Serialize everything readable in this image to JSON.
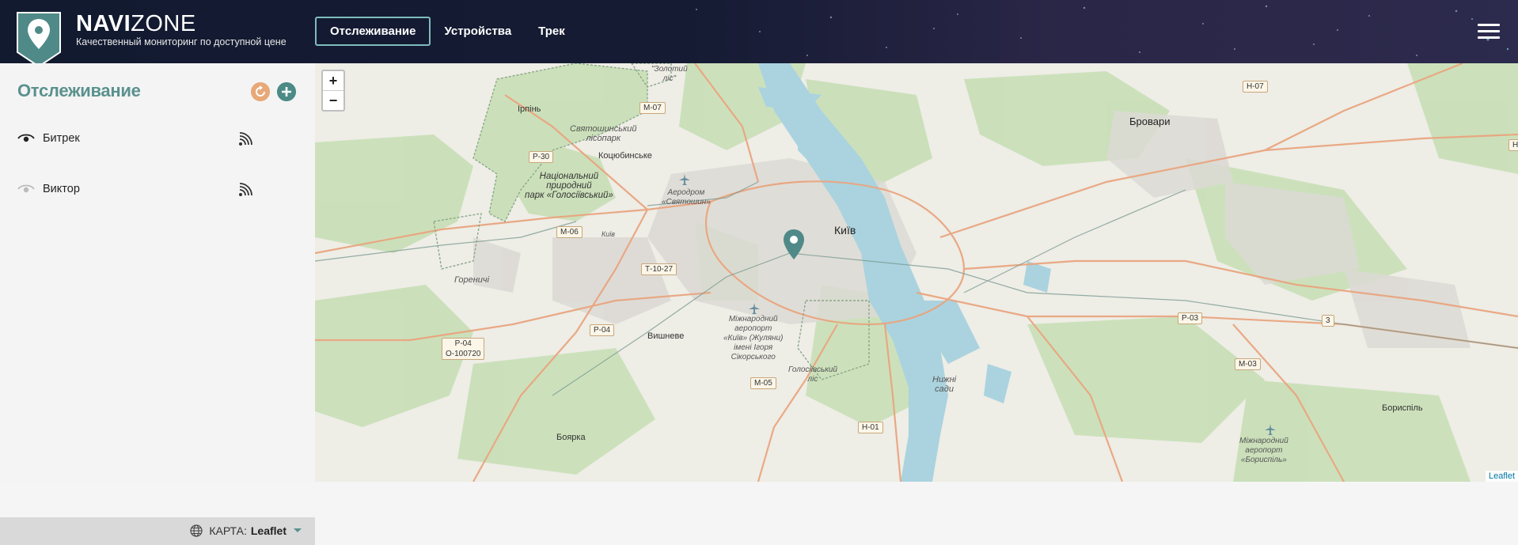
{
  "header": {
    "brand_bold": "NAVI",
    "brand_light": "ZONE",
    "tagline": "Качественный мониторинг по доступной цене",
    "tabs": [
      {
        "label": "Отслеживание"
      },
      {
        "label": "Устройства"
      },
      {
        "label": "Трек"
      }
    ]
  },
  "sidebar": {
    "title": "Отслеживание",
    "devices": [
      {
        "name": "Битрек",
        "visible": true
      },
      {
        "name": "Виктор",
        "visible": false
      }
    ],
    "map_label": "КАРТА:",
    "map_value": "Leaflet"
  },
  "map": {
    "zoom_in": "+",
    "zoom_out": "−",
    "attribution": "Leaflet",
    "places": {
      "irpin": "Ірпінь",
      "kotsiubynske": "Коцюбинське",
      "kyiv": "Київ",
      "brovary": "Бровари",
      "vyshneve": "Вишневе",
      "boiarka": "Боярка",
      "boryspil": "Бориспіль",
      "horenychi": "Гореничі",
      "kyiv_small": "Київ",
      "nyzhni_sady": "Нижні\nсади"
    },
    "areas": {
      "zolotyi_lis": "\"Золотий\nліс\"",
      "sviatoshynskyi": "Святошинський\nлісопарк",
      "nat_park": "Національний\nприродний\nпарк «Голосіївський»",
      "aerodrom": "Аеродром\n«Святошин»",
      "airport": "Міжнародний\nаеропорт\n«Київ» (Жуляни)\nімені Ігоря\nСікорського",
      "holosiivskyi": "Голосіївський\nліс",
      "boryspil_airport": "Міжнародний\nаеропорт\n«Бориспіль»"
    },
    "roads": {
      "m07": "М-07",
      "p30": "Р-30",
      "m06": "М-06",
      "t1027": "Т-10-27",
      "p04a": "Р-04",
      "p04b": "Р-04\nО-100720",
      "m05": "М-05",
      "h01": "Н-01",
      "h07": "Н-07",
      "p03": "Р-03",
      "m03": "М-03",
      "h_edge": "Н",
      "b3": "3"
    }
  },
  "colors": {
    "accent": "#5a918e",
    "marker": "#4f8a88",
    "refresh": "#e8a878"
  }
}
